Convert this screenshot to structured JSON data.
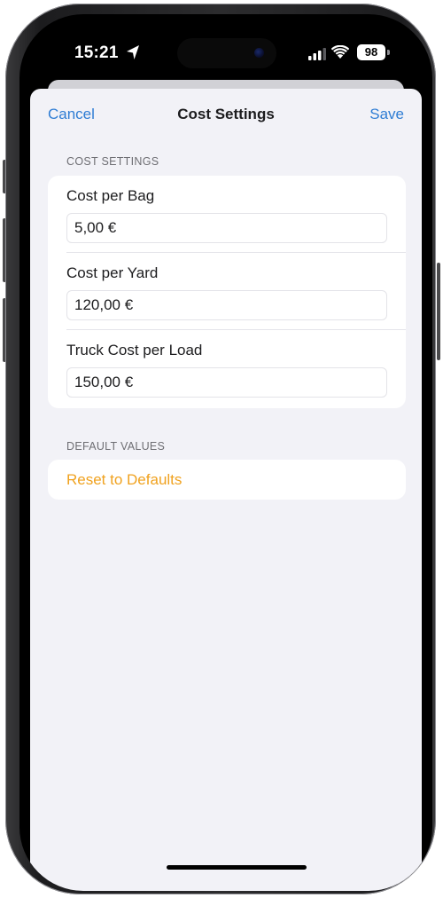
{
  "status_bar": {
    "time": "15:21",
    "battery": "98",
    "icons": [
      "location-arrow-icon",
      "cellular-signal-icon",
      "wifi-icon",
      "battery-icon"
    ]
  },
  "nav": {
    "cancel_label": "Cancel",
    "title": "Cost Settings",
    "save_label": "Save",
    "accent_color": "#2f7dd4"
  },
  "sections": {
    "cost_settings": {
      "header": "COST SETTINGS",
      "fields": [
        {
          "label": "Cost per Bag",
          "value": "5,00 €"
        },
        {
          "label": "Cost per Yard",
          "value": "120,00 €"
        },
        {
          "label": "Truck Cost per Load",
          "value": "150,00 €"
        }
      ]
    },
    "default_values": {
      "header": "DEFAULT VALUES",
      "reset_label": "Reset to Defaults",
      "reset_color": "#f0a21f"
    }
  }
}
